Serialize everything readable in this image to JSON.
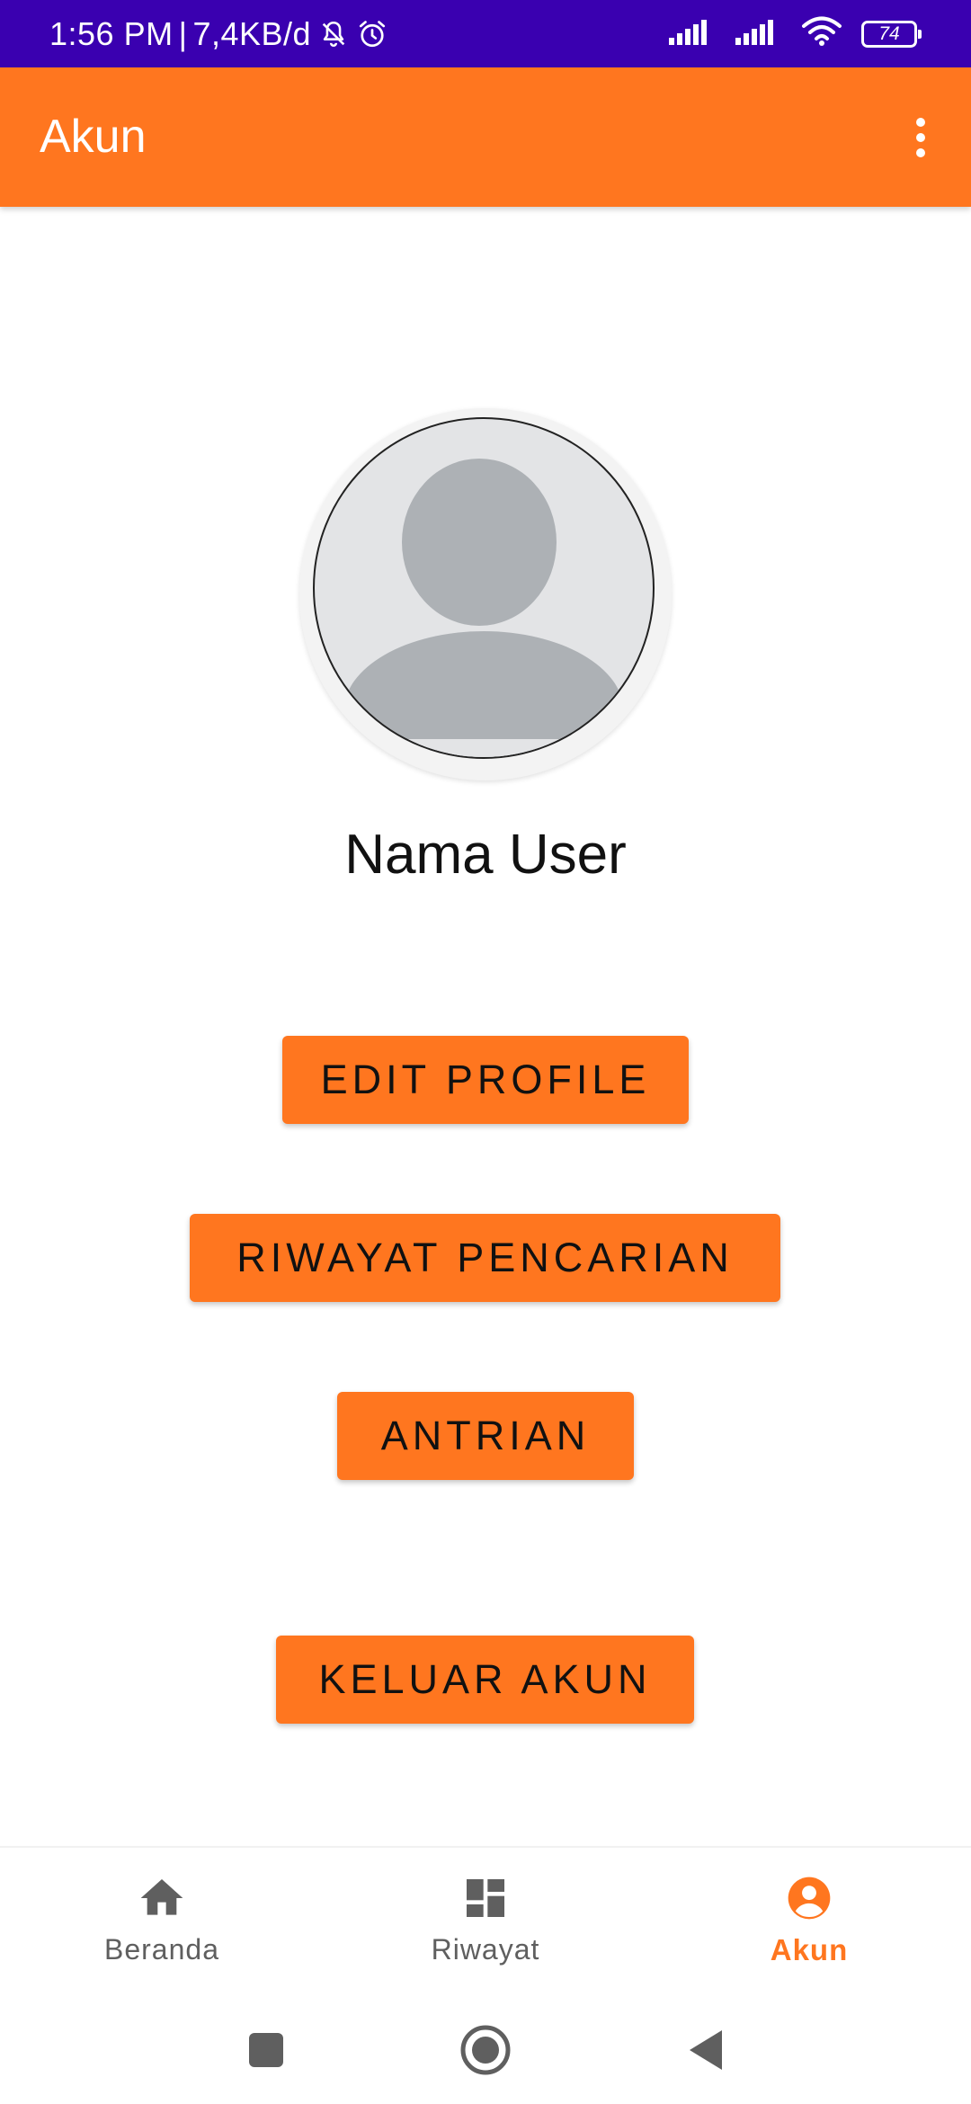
{
  "status_bar": {
    "time": "1:56 PM",
    "separator": "|",
    "data_rate": "7,4KB/d",
    "battery_level": "74",
    "background_color": "#3a00b0",
    "icons": [
      "bell-off-icon",
      "alarm-icon",
      "signal-icon",
      "signal-icon",
      "wifi-icon",
      "battery-icon"
    ]
  },
  "app_bar": {
    "title": "Akun",
    "menu_icon": "more-vertical-icon",
    "background_color": "#ff761f"
  },
  "profile": {
    "avatar_icon": "default-avatar-icon",
    "name": "Nama User"
  },
  "buttons": {
    "edit_profile": "EDIT PROFILE",
    "riwayat_pencarian": "RIWAYAT PENCARIAN",
    "antrian": "ANTRIAN",
    "keluar_akun": "KELUAR AKUN",
    "color": "#ff761f"
  },
  "bottom_nav": {
    "items": [
      {
        "label": "Beranda",
        "icon": "home-icon",
        "active": false
      },
      {
        "label": "Riwayat",
        "icon": "dashboard-icon",
        "active": false
      },
      {
        "label": "Akun",
        "icon": "account-circle-icon",
        "active": true
      }
    ],
    "active_color": "#ff761f",
    "inactive_color": "#5f5f5f"
  },
  "system_nav": {
    "icons": [
      "recents-square-icon",
      "home-circle-icon",
      "back-triangle-icon"
    ]
  }
}
